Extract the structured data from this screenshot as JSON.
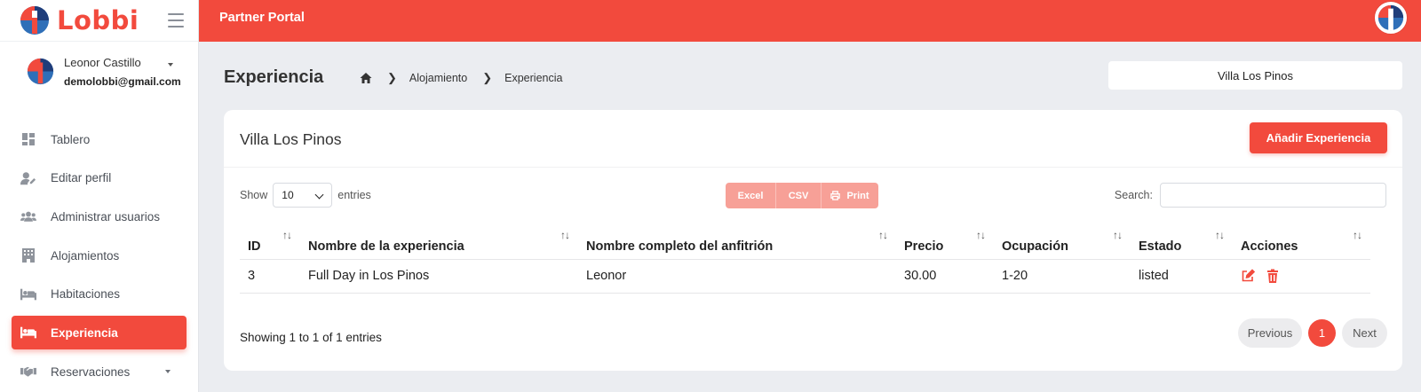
{
  "brand": {
    "name": "Lobbi",
    "accent": "#f24a3d"
  },
  "topbar": {
    "title": "Partner Portal"
  },
  "user": {
    "name": "Leonor Castillo",
    "email": "demolobbi@gmail.com"
  },
  "sidebar": {
    "items": [
      {
        "label": "Tablero",
        "icon": "dashboard-icon"
      },
      {
        "label": "Editar perfil",
        "icon": "user-edit-icon"
      },
      {
        "label": "Administrar usuarios",
        "icon": "users-icon"
      },
      {
        "label": "Alojamientos",
        "icon": "building-icon"
      },
      {
        "label": "Habitaciones",
        "icon": "bed-icon"
      },
      {
        "label": "Experiencia",
        "icon": "bed-icon",
        "active": true
      },
      {
        "label": "Reservaciones",
        "icon": "handshake-icon",
        "expandable": true
      }
    ]
  },
  "page": {
    "title": "Experiencia",
    "breadcrumb": [
      "Alojamiento",
      "Experiencia"
    ],
    "property_selector": "Villa Los Pinos"
  },
  "card": {
    "title": "Villa Los Pinos",
    "add_button": "Añadir Experiencia"
  },
  "controls": {
    "show_label": "Show",
    "page_size": "10",
    "entries_label": "entries",
    "export_buttons": [
      "Excel",
      "CSV",
      "Print"
    ],
    "search_label": "Search:",
    "search_value": ""
  },
  "table": {
    "columns": [
      "ID",
      "Nombre de la experiencia",
      "Nombre completo del anfitrión",
      "Precio",
      "Ocupación",
      "Estado",
      "Acciones"
    ],
    "rows": [
      {
        "id": "3",
        "name": "Full Day in Los Pinos",
        "host": "Leonor",
        "price": "30.00",
        "occupancy": "1-20",
        "status": "listed"
      }
    ]
  },
  "footer": {
    "info": "Showing 1 to 1 of 1 entries",
    "prev": "Previous",
    "page": "1",
    "next": "Next"
  }
}
